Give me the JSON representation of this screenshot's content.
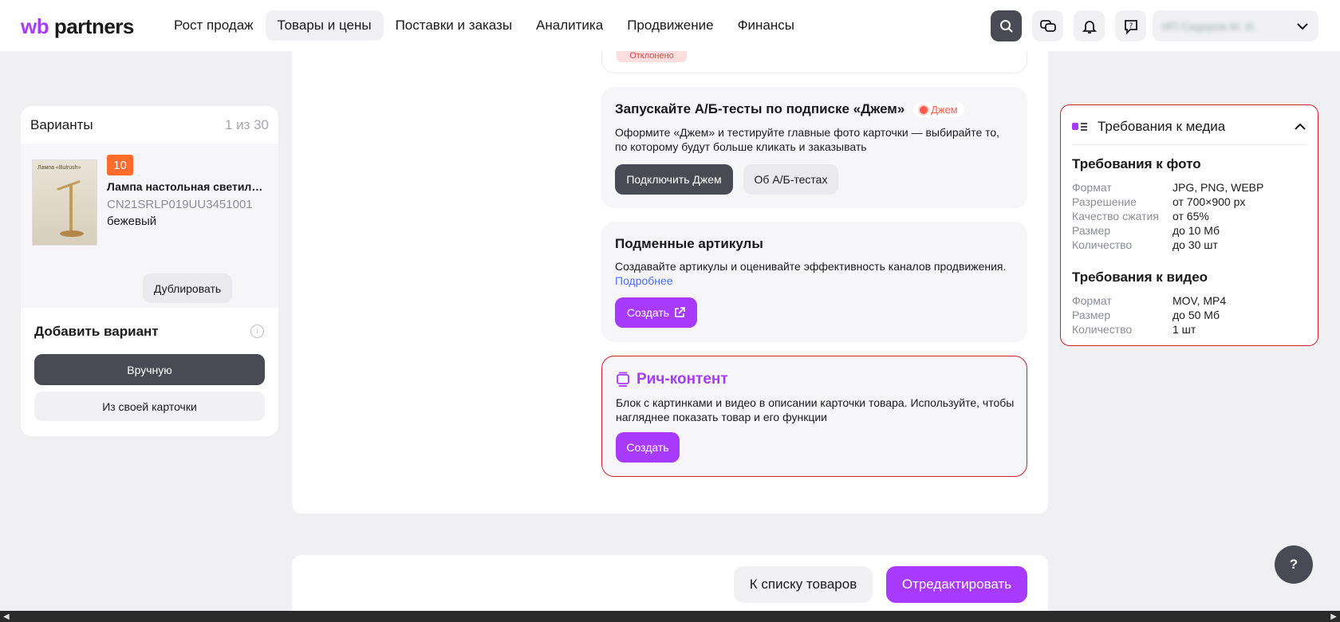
{
  "header": {
    "logo_wb": "wb",
    "logo_partners": "partners",
    "nav": [
      {
        "label": "Рост продаж"
      },
      {
        "label": "Товары и цены"
      },
      {
        "label": "Поставки и заказы"
      },
      {
        "label": "Аналитика"
      },
      {
        "label": "Продвижение"
      },
      {
        "label": "Финансы"
      }
    ],
    "user_name": "ИП Сидоров М. И."
  },
  "left": {
    "title": "Варианты",
    "count": "1 из 30",
    "variant": {
      "badge": "10",
      "thumb_text": "Лампа «Bulrush»",
      "name": "Лампа настольная светильник",
      "article": "CN21SRLP019UU3451001",
      "color": "бежевый",
      "duplicate_label": "Дублировать"
    },
    "add_title": "Добавить вариант",
    "manual_label": "Вручную",
    "own_label": "Из своей карточки"
  },
  "main": {
    "rejected_label": "Отклонено",
    "ab": {
      "title": "Запускайте А/Б-тесты по подписке «Джем»",
      "chip": "Джем",
      "text": "Оформите «Джем» и тестируйте главные фото карточки — выбирайте то, по которому будут больше кликать и заказывать",
      "connect_label": "Подключить Джем",
      "about_label": "Об А/Б-тестах"
    },
    "sub": {
      "title": "Подменные артикулы",
      "text": "Создавайте артикулы и оценивайте эффективность каналов продвижения.",
      "more": "Подробнее",
      "create_label": "Создать"
    },
    "rich": {
      "title": "Рич-контент",
      "text": "Блок с картинками и видео в описании карточки товара. Используйте, чтобы нагляднее показать товар и его функции",
      "create_label": "Создать"
    }
  },
  "media": {
    "title": "Требования к медиа",
    "photo_title": "Требования к фото",
    "photo_rows": [
      {
        "k": "Формат",
        "v": "JPG, PNG, WEBP"
      },
      {
        "k": "Разрешение",
        "v": "от 700×900 px"
      },
      {
        "k": "Качество сжатия",
        "v": "от 65%"
      },
      {
        "k": "Размер",
        "v": "до 10 Мб"
      },
      {
        "k": "Количество",
        "v": "до 30 шт"
      }
    ],
    "video_title": "Требования к видео",
    "video_rows": [
      {
        "k": "Формат",
        "v": "MOV, MP4"
      },
      {
        "k": "Размер",
        "v": "до 50 Мб"
      },
      {
        "k": "Количество",
        "v": "1 шт"
      }
    ]
  },
  "footer": {
    "back_label": "К списку товаров",
    "edit_label": "Отредактировать"
  },
  "help_label": "?",
  "colors": {
    "accent": "#a73afd",
    "dark": "#4a4a55",
    "highlight": "#d0202a"
  }
}
